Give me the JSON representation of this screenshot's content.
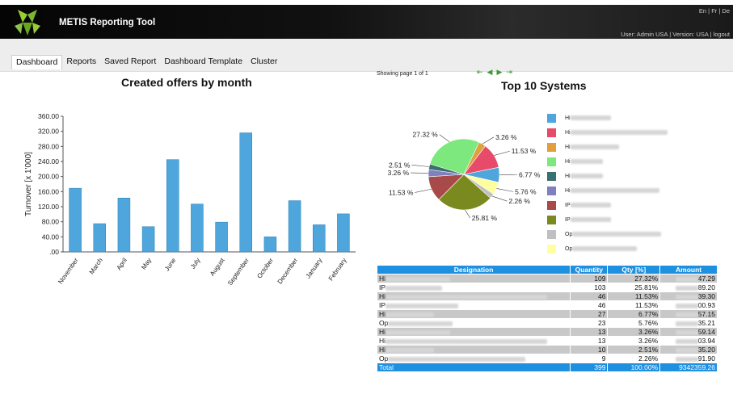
{
  "header": {
    "app_title": "METIS Reporting Tool",
    "languages": [
      "En",
      "Fr",
      "De"
    ],
    "user_info": "User: Admin USA | Version: USA | logout"
  },
  "tabs": [
    "Dashboard",
    "Reports",
    "Saved Report",
    "Dashboard Template",
    "Cluster"
  ],
  "active_tab": 0,
  "pager": {
    "text": "Showing page 1 of 1"
  },
  "colors": {
    "bar": "#4ea6dc",
    "header_bg": "#111111",
    "table_header": "#1e90e0"
  },
  "chart_data": [
    {
      "type": "bar",
      "title": "Created offers by month",
      "ylabel": "Turnover [x 1'000]",
      "xlabel": "",
      "ylim": [
        0,
        360
      ],
      "yticks": [
        "360.00",
        "320.00",
        "280.00",
        "240.00",
        "200.00",
        "160.00",
        "120.00",
        "80.00",
        "40.00",
        ".00"
      ],
      "categories": [
        "November",
        "March",
        "April",
        "May",
        "June",
        "July",
        "August",
        "September",
        "October",
        "December",
        "January",
        "February"
      ],
      "values": [
        169,
        75,
        143,
        67,
        245,
        127,
        79,
        316,
        40,
        136,
        72,
        101
      ]
    },
    {
      "type": "pie",
      "title": "Top 10 Systems",
      "slices": [
        {
          "label": "27.32 %",
          "value": 27.32,
          "color": "#7de87d"
        },
        {
          "label": "3.26 %",
          "value": 3.26,
          "color": "#e0a040"
        },
        {
          "label": "11.53 %",
          "value": 11.53,
          "color": "#e84a6a"
        },
        {
          "label": "6.77 %",
          "value": 6.77,
          "color": "#4ea6dc"
        },
        {
          "label": "5.76 %",
          "value": 5.76,
          "color": "#ffffa0"
        },
        {
          "label": "2.26 %",
          "value": 2.26,
          "color": "#c0c0c0"
        },
        {
          "label": "25.81 %",
          "value": 25.81,
          "color": "#7a8a1e"
        },
        {
          "label": "11.53 %",
          "value": 11.53,
          "color": "#a84a4a"
        },
        {
          "label": "3.26 %",
          "value": 3.26,
          "color": "#8080c0"
        },
        {
          "label": "2.51 %",
          "value": 2.51,
          "color": "#3a7070"
        }
      ],
      "legend": [
        {
          "prefix": "Hi",
          "color": "#4ea6dc"
        },
        {
          "prefix": "Hi",
          "color": "#e84a6a"
        },
        {
          "prefix": "Hi",
          "color": "#e0a040"
        },
        {
          "prefix": "Hi",
          "color": "#7de87d"
        },
        {
          "prefix": "Hi",
          "color": "#3a7070"
        },
        {
          "prefix": "Hi",
          "color": "#8080c0"
        },
        {
          "prefix": "IP",
          "color": "#a84a4a"
        },
        {
          "prefix": "IP",
          "color": "#7a8a1e"
        },
        {
          "prefix": "Op",
          "color": "#c0c0c0"
        },
        {
          "prefix": "Op",
          "color": "#ffffa0"
        }
      ]
    }
  ],
  "table": {
    "headers": [
      "Designation",
      "Quantity",
      "Qty [%]",
      "Amount"
    ],
    "rows": [
      {
        "designation": "Hi",
        "quantity": "109",
        "qty_pct": "27.32%",
        "amount": "47.29"
      },
      {
        "designation": "IP",
        "quantity": "103",
        "qty_pct": "25.81%",
        "amount": "89.20"
      },
      {
        "designation": "Hi",
        "quantity": "46",
        "qty_pct": "11.53%",
        "amount": "39.30"
      },
      {
        "designation": "IP",
        "quantity": "46",
        "qty_pct": "11.53%",
        "amount": "00.93"
      },
      {
        "designation": "Hi",
        "quantity": "27",
        "qty_pct": "6.77%",
        "amount": "57.15"
      },
      {
        "designation": "Op",
        "quantity": "23",
        "qty_pct": "5.76%",
        "amount": "35.21"
      },
      {
        "designation": "Hi",
        "quantity": "13",
        "qty_pct": "3.26%",
        "amount": "59.14"
      },
      {
        "designation": "Hi",
        "quantity": "13",
        "qty_pct": "3.26%",
        "amount": "03.94"
      },
      {
        "designation": "Hi",
        "quantity": "10",
        "qty_pct": "2.51%",
        "amount": "35.20"
      },
      {
        "designation": "Op",
        "quantity": "9",
        "qty_pct": "2.26%",
        "amount": "91.90"
      }
    ],
    "total": {
      "designation": "Total",
      "quantity": "399",
      "qty_pct": "100.00%",
      "amount": "9342359.26"
    }
  }
}
